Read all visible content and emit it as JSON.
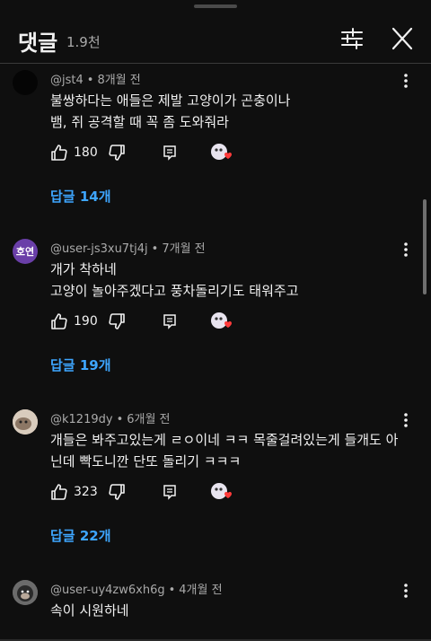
{
  "header": {
    "title": "댓글",
    "count": "1.9천",
    "filter_icon": "sliders-icon",
    "close_icon": "close-icon"
  },
  "colors": {
    "link": "#3ea6ff",
    "background": "#0f0f0f",
    "heart": "#ff3b3b"
  },
  "comments": [
    {
      "author": "@jst4",
      "time": "8개월 전",
      "lines": [
        "불쌍하다는 애들은 제발 고양이가 곤충이나",
        "뱀, 쥐 공격할 때 꼭 좀 도와줘라"
      ],
      "likes": "180",
      "replies": "답글 14개"
    },
    {
      "author": "@user-js3xu7tj4j",
      "time": "7개월 전",
      "avatar_text": "호연",
      "lines": [
        "개가 착하네",
        "고양이 놀아주겠다고 풍차돌리기도 태워주고"
      ],
      "likes": "190",
      "replies": "답글 19개"
    },
    {
      "author": "@k1219dy",
      "time": "6개월 전",
      "lines": [
        "개들은 봐주고있는게 ㄹㅇ이네 ㅋㅋ 목줄걸려있는게 들개도 아",
        "닌데 빡도니깐 단또 돌리기 ㅋㅋㅋ"
      ],
      "likes": "323",
      "replies": "답글 22개"
    },
    {
      "author": "@user-uy4zw6xh6g",
      "time": "4개월 전",
      "lines": [
        "속이 시원하네"
      ]
    }
  ]
}
